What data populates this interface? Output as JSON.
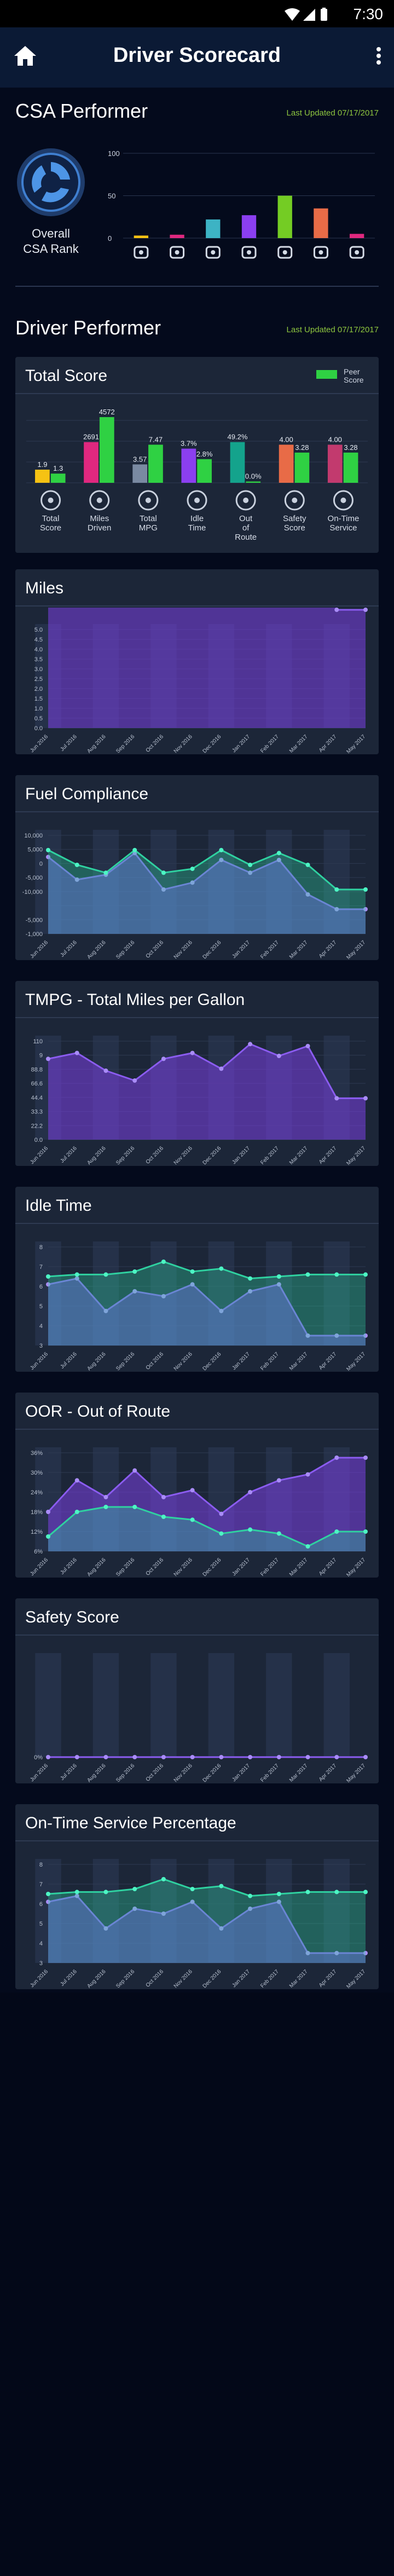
{
  "status": {
    "time": "7:30"
  },
  "header": {
    "title": "Driver Scorecard"
  },
  "csa": {
    "title": "CSA Performer",
    "updated": "Last Updated 07/17/2017",
    "rank_label_1": "Overall",
    "rank_label_2": "CSA Rank",
    "axis": [
      "100",
      "50",
      "0"
    ]
  },
  "driver": {
    "title": "Driver Performer",
    "updated": "Last Updated 07/17/2017"
  },
  "colors": {
    "purple": "#7b3fe4",
    "green": "#2fd1a0",
    "peer": "#2fd143",
    "yellow": "#f6c213",
    "pink": "#e0287f"
  },
  "cards": {
    "total": {
      "title": "Total Score",
      "legend": "Peer Score"
    },
    "miles": {
      "title": "Miles"
    },
    "fuel": {
      "title": "Fuel Compliance"
    },
    "tmpg": {
      "title": "TMPG - Total Miles per Gallon"
    },
    "idle": {
      "title": "Idle Time"
    },
    "oor": {
      "title": "OOR - Out of Route"
    },
    "safety": {
      "title": "Safety Score"
    },
    "ontime": {
      "title": "On-Time Service Percentage"
    }
  },
  "chart_data": [
    {
      "type": "bar",
      "title": "CSA Performer",
      "ylim": [
        0,
        100
      ],
      "categories": [
        "1",
        "2",
        "3",
        "4",
        "5",
        "6",
        "7"
      ],
      "icons": [
        "steering-wheel-icon",
        "sleep-icon",
        "driver-icon",
        "seat-icon",
        "key-icon",
        "road-icon",
        "crash-icon"
      ],
      "values": [
        3,
        4,
        22,
        27,
        50,
        35,
        5
      ],
      "colors": [
        "#f6c213",
        "#e0287f",
        "#3db3c4",
        "#8b3ff0",
        "#74cc24",
        "#e86b47",
        "#e0287f"
      ]
    },
    {
      "type": "bar",
      "title": "Total Score",
      "categories": [
        "Total Score",
        "Miles Driven",
        "Total MPG",
        "Idle Time",
        "Out of Route",
        "Safety Score",
        "On-Time Service"
      ],
      "series": [
        {
          "name": "Driver",
          "labels": [
            "1.9",
            "2691",
            "3.57",
            "3.7%",
            "49.2%",
            "4.00",
            "4.00"
          ],
          "values": [
            0.2,
            0.62,
            0.28,
            0.52,
            0.62,
            0.58,
            0.58
          ]
        },
        {
          "name": "Peer Score",
          "labels": [
            "1.3",
            "4572",
            "7.47",
            "2.8%",
            "0.0%",
            "3.28",
            "3.28"
          ],
          "values": [
            0.14,
            1.0,
            0.58,
            0.36,
            0.02,
            0.46,
            0.46
          ]
        }
      ],
      "bar_colors": [
        "#f6c213",
        "#e0287f",
        "#7a8aa2",
        "#8b3ff0",
        "#14a38c",
        "#e86b47",
        "#c23a6e"
      ],
      "peer_color": "#2fd143"
    },
    {
      "type": "area",
      "title": "Miles",
      "x": [
        "Jun 2016",
        "Jul 2016",
        "Aug 2016",
        "Sep 2016",
        "Oct 2016",
        "Nov 2016",
        "Dec 2016",
        "Jan 2017",
        "Feb 2017",
        "Mar 2017",
        "Apr 2017",
        "May 2017"
      ],
      "yticks": [
        "5.0",
        "4.5",
        "4.0",
        "3.5",
        "3.0",
        "2.5",
        "2.0",
        "1.5",
        "1.0",
        "0.5",
        "0.0"
      ],
      "ylim": [
        0,
        5
      ],
      "series": [
        {
          "name": "Driver",
          "values": [
            1.7,
            2.2,
            1.7,
            1.8,
            2.2,
            1.9,
            1.7,
            3.4,
            1.9,
            3.7,
            1.2,
            1.2
          ]
        }
      ]
    },
    {
      "type": "area",
      "title": "Fuel Compliance",
      "x": [
        "Jun 2016",
        "Jul 2016",
        "Aug 2016",
        "Sep 2016",
        "Oct 2016",
        "Nov 2016",
        "Dec 2016",
        "Jan 2017",
        "Feb 2017",
        "Mar 2017",
        "Apr 2017",
        "May 2017"
      ],
      "yticks": [
        "10,000",
        "5,000",
        "0",
        "-5,000",
        "-10,000",
        "",
        "-5,000",
        "-1,000"
      ],
      "series": [
        {
          "name": "Driver",
          "values": [
            0.78,
            0.55,
            0.6,
            0.82,
            0.45,
            0.52,
            0.75,
            0.62,
            0.75,
            0.4,
            0.25,
            0.25
          ]
        },
        {
          "name": "Peer",
          "values": [
            0.85,
            0.7,
            0.62,
            0.85,
            0.62,
            0.66,
            0.85,
            0.7,
            0.82,
            0.7,
            0.45,
            0.45
          ]
        }
      ]
    },
    {
      "type": "area",
      "title": "TMPG - Total Miles per Gallon",
      "x": [
        "Jun 2016",
        "Jul 2016",
        "Aug 2016",
        "Sep 2016",
        "Oct 2016",
        "Nov 2016",
        "Dec 2016",
        "Jan 2017",
        "Feb 2017",
        "Mar 2017",
        "Apr 2017",
        "May 2017"
      ],
      "yticks": [
        "110",
        "9",
        "88.8",
        "66.6",
        "44.4",
        "33.3",
        "22.2",
        "0.0"
      ],
      "series": [
        {
          "name": "Driver",
          "values": [
            0.82,
            0.88,
            0.7,
            0.6,
            0.82,
            0.88,
            0.72,
            0.97,
            0.85,
            0.95,
            0.42,
            0.42
          ]
        }
      ]
    },
    {
      "type": "area",
      "title": "Idle Time",
      "x": [
        "Jun 2016",
        "Jul 2016",
        "Aug 2016",
        "Sep 2016",
        "Oct 2016",
        "Nov 2016",
        "Dec 2016",
        "Jan 2017",
        "Feb 2017",
        "Mar 2017",
        "Apr 2017",
        "May 2017"
      ],
      "yticks": [
        "8",
        "7",
        "6",
        "5",
        "4",
        "3"
      ],
      "series": [
        {
          "name": "Driver",
          "values": [
            0.62,
            0.68,
            0.35,
            0.55,
            0.5,
            0.62,
            0.35,
            0.55,
            0.62,
            0.1,
            0.1,
            0.1
          ]
        },
        {
          "name": "Peer",
          "values": [
            0.7,
            0.72,
            0.72,
            0.75,
            0.85,
            0.75,
            0.78,
            0.68,
            0.7,
            0.72,
            0.72,
            0.72
          ]
        }
      ]
    },
    {
      "type": "area",
      "title": "OOR - Out of Route",
      "x": [
        "Jun 2016",
        "Jul 2016",
        "Aug 2016",
        "Sep 2016",
        "Oct 2016",
        "Nov 2016",
        "Dec 2016",
        "Jan 2017",
        "Feb 2017",
        "Mar 2017",
        "Apr 2017",
        "May 2017"
      ],
      "yticks": [
        "36%",
        "30%",
        "24%",
        "18%",
        "12%",
        "6%"
      ],
      "series": [
        {
          "name": "Driver",
          "values": [
            0.4,
            0.72,
            0.55,
            0.82,
            0.55,
            0.62,
            0.38,
            0.6,
            0.72,
            0.78,
            0.95,
            0.95
          ]
        },
        {
          "name": "Peer",
          "values": [
            0.15,
            0.4,
            0.45,
            0.45,
            0.35,
            0.32,
            0.18,
            0.22,
            0.18,
            0.05,
            0.2,
            0.2
          ]
        }
      ]
    },
    {
      "type": "area",
      "title": "Safety Score",
      "x": [
        "Jun 2016",
        "Jul 2016",
        "Aug 2016",
        "Sep 2016",
        "Oct 2016",
        "Nov 2016",
        "Dec 2016",
        "Jan 2017",
        "Feb 2017",
        "Mar 2017",
        "Apr 2017",
        "May 2017"
      ],
      "yticks": [
        "0%"
      ],
      "series": [
        {
          "name": "Driver",
          "values": [
            0,
            0,
            0,
            0,
            0,
            0,
            0,
            0,
            0,
            0,
            0,
            0
          ]
        }
      ]
    },
    {
      "type": "area",
      "title": "On-Time Service Percentage",
      "x": [
        "Jun 2016",
        "Jul 2016",
        "Aug 2016",
        "Sep 2016",
        "Oct 2016",
        "Nov 2016",
        "Dec 2016",
        "Jan 2017",
        "Feb 2017",
        "Mar 2017",
        "Apr 2017",
        "May 2017"
      ],
      "yticks": [
        "8",
        "7",
        "6",
        "5",
        "4",
        "3"
      ],
      "series": [
        {
          "name": "Driver",
          "values": [
            0.62,
            0.68,
            0.35,
            0.55,
            0.5,
            0.62,
            0.35,
            0.55,
            0.62,
            0.1,
            0.1,
            0.1
          ]
        },
        {
          "name": "Peer",
          "values": [
            0.7,
            0.72,
            0.72,
            0.75,
            0.85,
            0.75,
            0.78,
            0.68,
            0.7,
            0.72,
            0.72,
            0.72
          ]
        }
      ]
    }
  ]
}
